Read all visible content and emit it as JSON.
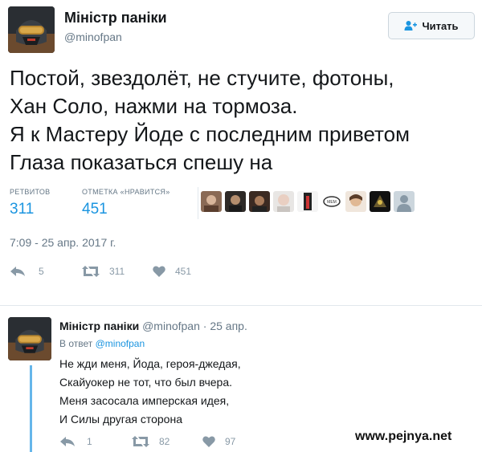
{
  "tweet": {
    "author_name": "Міністр паніки",
    "handle": "@minofpan",
    "follow_label": "Читать",
    "lines": [
      "Постой, звездолёт, не стучите, фотоны,",
      "Хан Соло, нажми на тормоза.",
      "Я к Мастеру Йоде с последним приветом",
      "Глаза показаться спешу на"
    ],
    "retweets_label": "РЕТВИТОВ",
    "retweets_value": "311",
    "likes_label": "ОТМЕТКА «НРАВИТСЯ»",
    "likes_value": "451",
    "timestamp": "7:09 - 25 апр. 2017 г.",
    "actions": {
      "reply_count": "5",
      "retweet_count": "311",
      "like_count": "451"
    }
  },
  "reply": {
    "author_name": "Міністр паніки",
    "handle": "@minofpan",
    "dot": "·",
    "date": "25 апр.",
    "reply_to_prefix": "В ответ",
    "reply_to_handle": "@minofpan",
    "lines": [
      "Не жди меня, Йода, героя-джедая,",
      "Скайуокер не тот, что был вчера.",
      "Меня засосала имперская идея,",
      "И Силы другая сторона"
    ],
    "actions": {
      "reply_count": "1",
      "retweet_count": "82",
      "like_count": "97"
    }
  },
  "watermark": "www.pejnya.net",
  "colors": {
    "accent": "#1b95e0",
    "muted": "#657786",
    "icon": "#8899a6",
    "thread": "#65b6ea"
  }
}
